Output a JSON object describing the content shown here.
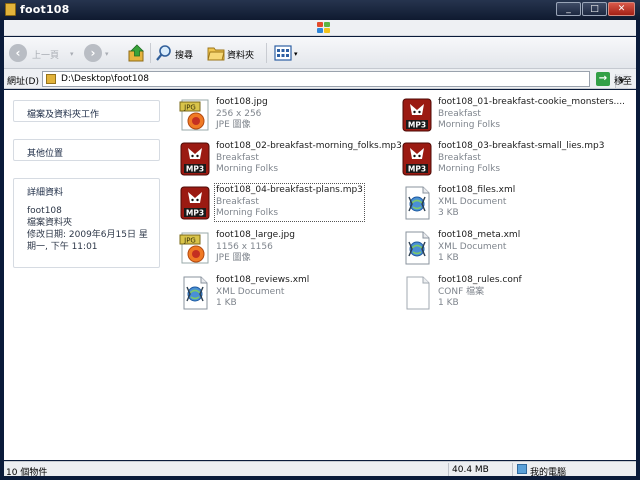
{
  "window": {
    "title": "foot108"
  },
  "toolbar": {
    "back_label": "上一頁",
    "search_label": "搜尋",
    "folders_label": "資料夾"
  },
  "address": {
    "label": "網址(D)",
    "value": "D:\\Desktop\\foot108",
    "go_label": "移至"
  },
  "tasks": {
    "file_folder_tasks": "檔案及資料夾工作",
    "other_places": "其他位置",
    "details": {
      "title": "詳細資料",
      "name": "foot108",
      "type": "檔案資料夾",
      "modified_line1": "修改日期: 2009年6月15日 星",
      "modified_line2": "期一, 下午 11:01"
    }
  },
  "files": [
    {
      "name": "foot108.jpg",
      "meta1": "256 x 256",
      "meta2": "JPE 圖像",
      "icon": "jpg-file-icon"
    },
    {
      "name": "foot108_01-breakfast-cookie_monsters....",
      "meta1": "Breakfast",
      "meta2": "Morning Folks",
      "icon": "mp3-file-icon"
    },
    {
      "name": "foot108_02-breakfast-morning_folks.mp3",
      "meta1": "Breakfast",
      "meta2": "Morning Folks",
      "icon": "mp3-file-icon"
    },
    {
      "name": "foot108_03-breakfast-small_lies.mp3",
      "meta1": "Breakfast",
      "meta2": "Morning Folks",
      "icon": "mp3-file-icon"
    },
    {
      "name": "foot108_04-breakfast-plans.mp3",
      "meta1": "Breakfast",
      "meta2": "Morning Folks",
      "icon": "mp3-file-icon"
    },
    {
      "name": "foot108_files.xml",
      "meta1": "XML Document",
      "meta2": "3 KB",
      "icon": "xml-file-icon"
    },
    {
      "name": "foot108_large.jpg",
      "meta1": "1156 x 1156",
      "meta2": "JPE 圖像",
      "icon": "jpg-file-icon"
    },
    {
      "name": "foot108_meta.xml",
      "meta1": "XML Document",
      "meta2": "1 KB",
      "icon": "xml-file-icon"
    },
    {
      "name": "foot108_reviews.xml",
      "meta1": "XML Document",
      "meta2": "1 KB",
      "icon": "xml-file-icon"
    },
    {
      "name": "foot108_rules.conf",
      "meta1": "CONF 檔案",
      "meta2": "1 KB",
      "icon": "conf-file-icon"
    }
  ],
  "status": {
    "count": "10 個物件",
    "size": "40.4 MB",
    "location": "我的電腦"
  },
  "colors": {
    "titlebar": "#0f1a30",
    "mp3_icon": "#9b1a12",
    "jpg_badge": "#d9c44a",
    "go_button": "#34a047"
  }
}
